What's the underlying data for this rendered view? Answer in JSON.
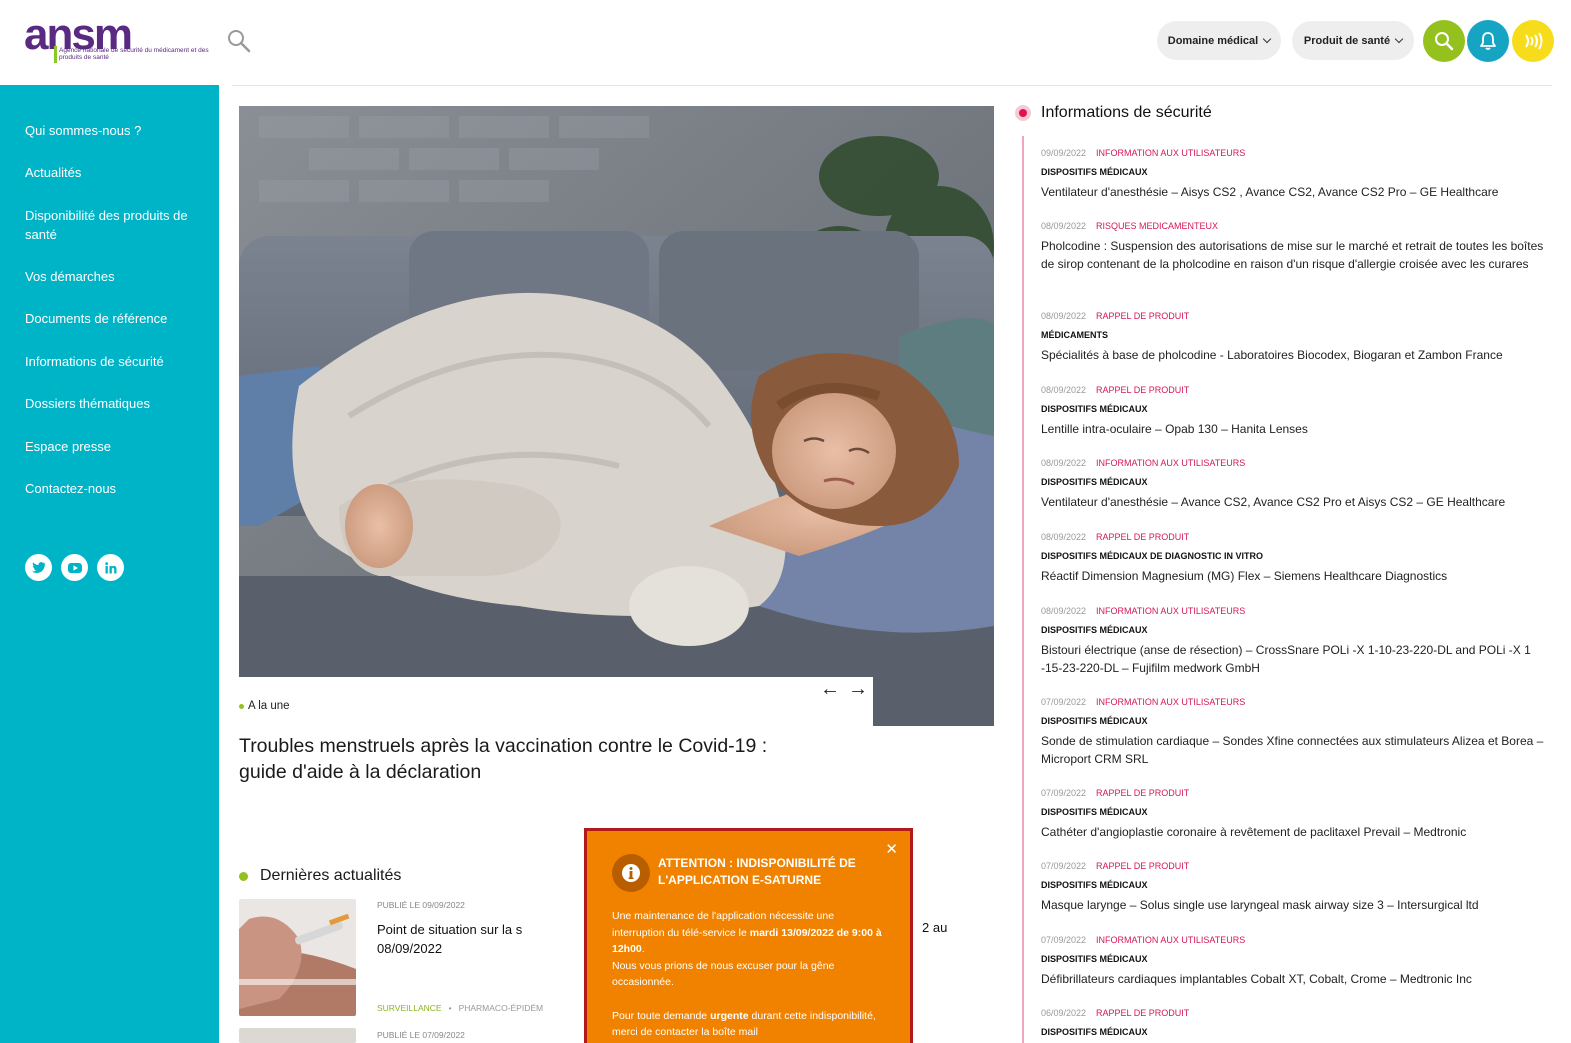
{
  "header": {
    "logo_word": "ansm",
    "logo_tagline": "Agence nationale de sécurité du médicament et des produits de santé",
    "filter_1": "Domaine médical",
    "filter_2": "Produit de santé"
  },
  "sidebar": {
    "items": [
      "Qui sommes-nous ?",
      "Actualités",
      "Disponibilité des produits de santé",
      "Vos démarches",
      "Documents de référence",
      "Informations de sécurité",
      "Dossiers thématiques",
      "Espace presse",
      "Contactez-nous"
    ],
    "social": [
      "twitter-icon",
      "youtube-icon",
      "linkedin-icon"
    ]
  },
  "hero": {
    "tag": "A la une",
    "title": "Troubles menstruels après la vaccination contre le Covid-19 : guide d'aide à la déclaration",
    "prev": "←",
    "next": "→"
  },
  "latest": {
    "heading": "Dernières actualités",
    "items": [
      {
        "date": "Publié le 09/09/2022",
        "title": "Point de situation sur la s 08/09/2022",
        "tag1": "Surveillance",
        "tag2": "Pharmaco-épidém",
        "title_right": "2 au"
      },
      {
        "date": "Publié le 07/09/2022"
      }
    ]
  },
  "modal": {
    "close": "✕",
    "title": "Attention : indisponibilité de l'application e-Saturne",
    "p1_a": "Une maintenance de l'application nécessite une interruption du télé-service le ",
    "p1_b": "mardi 13/09/2022 de 9:00 à 12h00",
    "p1_c": ".",
    "p2": "Nous vous prions de nous excuser pour la gêne occasionnée.",
    "p3_a": "Pour toute demande ",
    "p3_b": "urgente",
    "p3_c": " durant cette indisponibilité, merci de contacter la boîte mail"
  },
  "security": {
    "heading": "Informations de sécurité",
    "items": [
      {
        "date": "09/09/2022",
        "category": "Information aux utilisateurs",
        "domain": "Dispositifs médicaux",
        "title": "Ventilateur d'anesthésie – Aisys CS2 , Avance CS2, Avance CS2 Pro – GE Healthcare"
      },
      {
        "date": "08/09/2022",
        "category": "Risques medicamenteux",
        "domain": "",
        "title": "Pholcodine : Suspension des autorisations de mise sur le marché et retrait de toutes les boîtes de sirop contenant de la pholcodine en raison d'un risque d'allergie croisée avec les curares"
      },
      {
        "date": "08/09/2022",
        "category": "Rappel de produit",
        "domain": "Médicaments",
        "title": "Spécialités à base de pholcodine - Laboratoires Biocodex, Biogaran et Zambon France"
      },
      {
        "date": "08/09/2022",
        "category": "Rappel de produit",
        "domain": "Dispositifs médicaux",
        "title": "Lentille intra-oculaire – Opab 130 – Hanita Lenses"
      },
      {
        "date": "08/09/2022",
        "category": "Information aux utilisateurs",
        "domain": "Dispositifs médicaux",
        "title": "Ventilateur d'anesthésie – Avance CS2, Avance CS2 Pro et Aisys CS2 – GE Healthcare"
      },
      {
        "date": "08/09/2022",
        "category": "Rappel de produit",
        "domain": "Dispositifs médicaux de diagnostic in vitro",
        "title": "Réactif Dimension Magnesium (MG) Flex – Siemens Healthcare Diagnostics"
      },
      {
        "date": "08/09/2022",
        "category": "Information aux utilisateurs",
        "domain": "Dispositifs médicaux",
        "title": "Bistouri électrique (anse de résection) – CrossSnare POLi -X 1-10-23-220-DL and POLi -X 1 -15-23-220-DL – Fujifilm medwork GmbH"
      },
      {
        "date": "07/09/2022",
        "category": "Information aux utilisateurs",
        "domain": "Dispositifs médicaux",
        "title": "Sonde de stimulation cardiaque – Sondes Xfine connectées aux stimulateurs Alizea et Borea – Microport CRM SRL"
      },
      {
        "date": "07/09/2022",
        "category": "Rappel de produit",
        "domain": "Dispositifs médicaux",
        "title": "Cathéter d'angioplastie coronaire à revêtement de paclitaxel Prevail – Medtronic"
      },
      {
        "date": "07/09/2022",
        "category": "Rappel de produit",
        "domain": "Dispositifs médicaux",
        "title": "Masque larynge – Solus single use laryngeal mask airway size 3 – Intersurgical ltd"
      },
      {
        "date": "07/09/2022",
        "category": "Information aux utilisateurs",
        "domain": "Dispositifs médicaux",
        "title": "Défibrillateurs cardiaques implantables Cobalt XT, Cobalt, Crome – Medtronic Inc"
      },
      {
        "date": "06/09/2022",
        "category": "Rappel de produit",
        "domain": "Dispositifs médicaux",
        "title": ""
      }
    ]
  },
  "colors": {
    "sidebar": "#00b4c8",
    "brand_purple": "#5a2a82",
    "accent_green": "#95c11f",
    "accent_blue": "#16a4c3",
    "accent_yellow": "#f7dc1b",
    "security_pink": "#d3185a",
    "modal_orange": "#f08200"
  }
}
